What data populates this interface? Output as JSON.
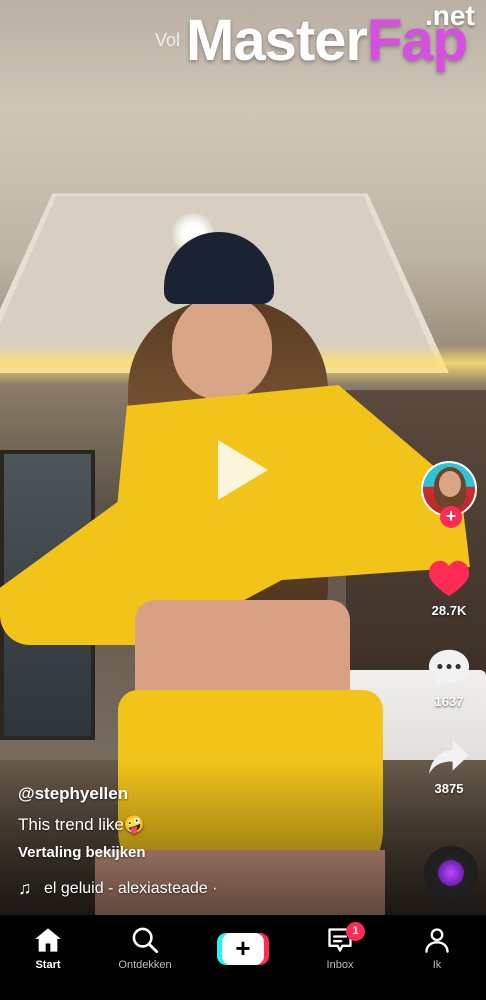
{
  "watermark": {
    "overlay_text": "Vol",
    "brand_master": "Master",
    "brand_fap": "Fap",
    "brand_net": ".net"
  },
  "creator": {
    "username": "@stephyellen",
    "follow_symbol": "+"
  },
  "actions": {
    "likes": "28.7K",
    "comments": "1637",
    "shares": "3875"
  },
  "caption": {
    "text": "This trend like🤪",
    "translate_label": "Vertaling bekijken"
  },
  "sound": {
    "note_symbol": "♫",
    "label": "el geluid - alexiasteade ·"
  },
  "nav": {
    "items": [
      {
        "label": "Start",
        "icon": "home-icon",
        "active": true
      },
      {
        "label": "Ontdekken",
        "icon": "search-icon",
        "active": false
      },
      {
        "label": "",
        "icon": "create-icon",
        "active": false
      },
      {
        "label": "Inbox",
        "icon": "inbox-icon",
        "active": false
      },
      {
        "label": "Ik",
        "icon": "profile-icon",
        "active": false
      }
    ],
    "create_symbol": "+",
    "inbox_badge": "1"
  },
  "colors": {
    "accent_red": "#fe2c55",
    "accent_cyan": "#25f4ee",
    "brand_magenta": "#d64fe3"
  }
}
